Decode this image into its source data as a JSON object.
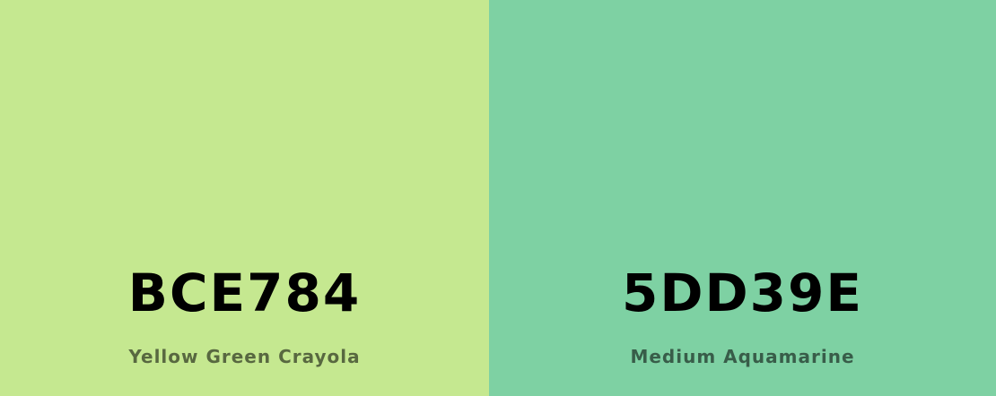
{
  "swatches": [
    {
      "hex": "BCE784",
      "name": "Yellow Green Crayola",
      "color": "#C5E890"
    },
    {
      "hex": "5DD39E",
      "name": "Medium Aquamarine",
      "color": "#7ED1A3"
    }
  ]
}
